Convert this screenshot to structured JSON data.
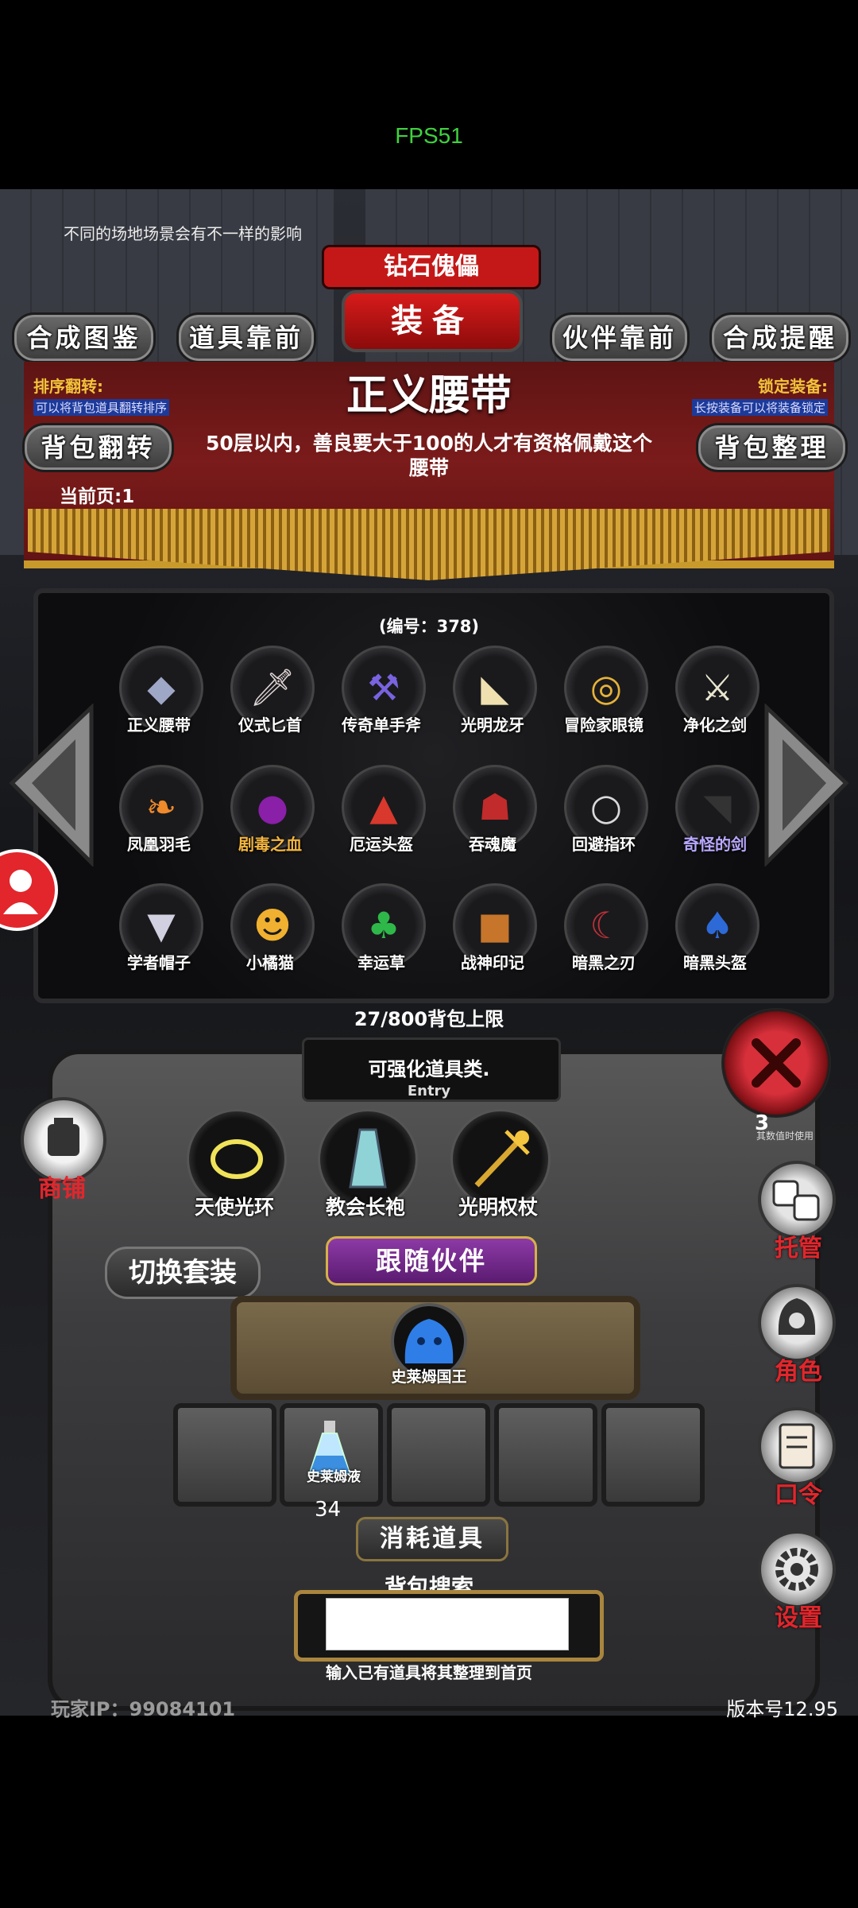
{
  "fps": "FPS51",
  "scene_tip": "不同的场地场景会有不一样的影响",
  "header": {
    "banner_title": "钻石傀儡",
    "panel_title": "装备",
    "buttons": {
      "synthesis_guide": "合成图鉴",
      "items_front": "道具靠前",
      "companions_front": "伙伴靠前",
      "synthesis_reminder": "合成提醒",
      "flip_bag": "背包翻转",
      "organize_bag": "背包整理"
    }
  },
  "sort_flip": {
    "label": "排序翻转:",
    "desc": "可以将背包道具翻转排序"
  },
  "lock_equip": {
    "label": "锁定装备:",
    "desc": "长按装备可以将装备锁定"
  },
  "selected_item": {
    "name": "正义腰带",
    "description": "50层以内，善良要大于100的人才有资格佩戴这个腰带",
    "serial": "(编号：378)"
  },
  "current_page": "当前页:1",
  "inventory": [
    {
      "name": "正义腰带",
      "icon": "belt-icon",
      "color": "white"
    },
    {
      "name": "仪式匕首",
      "icon": "dagger-icon",
      "color": "white"
    },
    {
      "name": "传奇单手斧",
      "icon": "axe-icon",
      "color": "white"
    },
    {
      "name": "光明龙牙",
      "icon": "fang-icon",
      "color": "white"
    },
    {
      "name": "冒险家眼镜",
      "icon": "goggles-icon",
      "color": "white"
    },
    {
      "name": "净化之剑",
      "icon": "sword-icon",
      "color": "white"
    },
    {
      "name": "凤凰羽毛",
      "icon": "feather-icon",
      "color": "white"
    },
    {
      "name": "剧毒之血",
      "icon": "poison-blood-icon",
      "color": "orange"
    },
    {
      "name": "厄运头盔",
      "icon": "helmet-icon",
      "color": "white"
    },
    {
      "name": "吞魂魔",
      "icon": "demon-icon",
      "color": "white"
    },
    {
      "name": "回避指环",
      "icon": "ring-icon",
      "color": "white"
    },
    {
      "name": "奇怪的剑",
      "icon": "strange-sword-icon",
      "color": "purple"
    },
    {
      "name": "学者帽子",
      "icon": "scholar-hat-icon",
      "color": "white"
    },
    {
      "name": "小橘猫",
      "icon": "cat-icon",
      "color": "white"
    },
    {
      "name": "幸运草",
      "icon": "clover-icon",
      "color": "white"
    },
    {
      "name": "战神印记",
      "icon": "war-seal-icon",
      "color": "white"
    },
    {
      "name": "暗黑之刃",
      "icon": "dark-blade-icon",
      "color": "white"
    },
    {
      "name": "暗黑头盔",
      "icon": "dark-helmet-icon",
      "color": "white"
    }
  ],
  "capacity": "27/800背包上限",
  "entry": {
    "title": "可强化道具类.",
    "sub": "Entry"
  },
  "equipped": [
    {
      "name": "天使光环",
      "icon": "halo-icon"
    },
    {
      "name": "教会长袍",
      "icon": "robe-icon"
    },
    {
      "name": "光明权杖",
      "icon": "scepter-icon"
    }
  ],
  "switch_set": "切换套装",
  "follow_companion": "跟随伙伴",
  "companion": {
    "name": "史莱姆国王",
    "icon": "slime-king-icon"
  },
  "consumables": {
    "title": "消耗道具",
    "slots": [
      {
        "name": "",
        "count": ""
      },
      {
        "name": "史莱姆液",
        "count": "34"
      },
      {
        "name": "",
        "count": ""
      },
      {
        "name": "",
        "count": ""
      },
      {
        "name": "",
        "count": ""
      }
    ]
  },
  "search": {
    "title": "背包搜索",
    "value": "",
    "hint": "输入已有道具将其整理到首页"
  },
  "player_ip": "玩家IP：99084101",
  "version": "版本号12.95",
  "side": {
    "shop": "商铺",
    "manage": "托管",
    "role": "角色",
    "command": "口令",
    "settings": "设置",
    "percent_text": "其数值时使用"
  },
  "colors": {
    "accent_red": "#e2262c",
    "gold": "#f2c33a",
    "orange_item": "#f4b640",
    "purple_item": "#b9a8ff"
  }
}
